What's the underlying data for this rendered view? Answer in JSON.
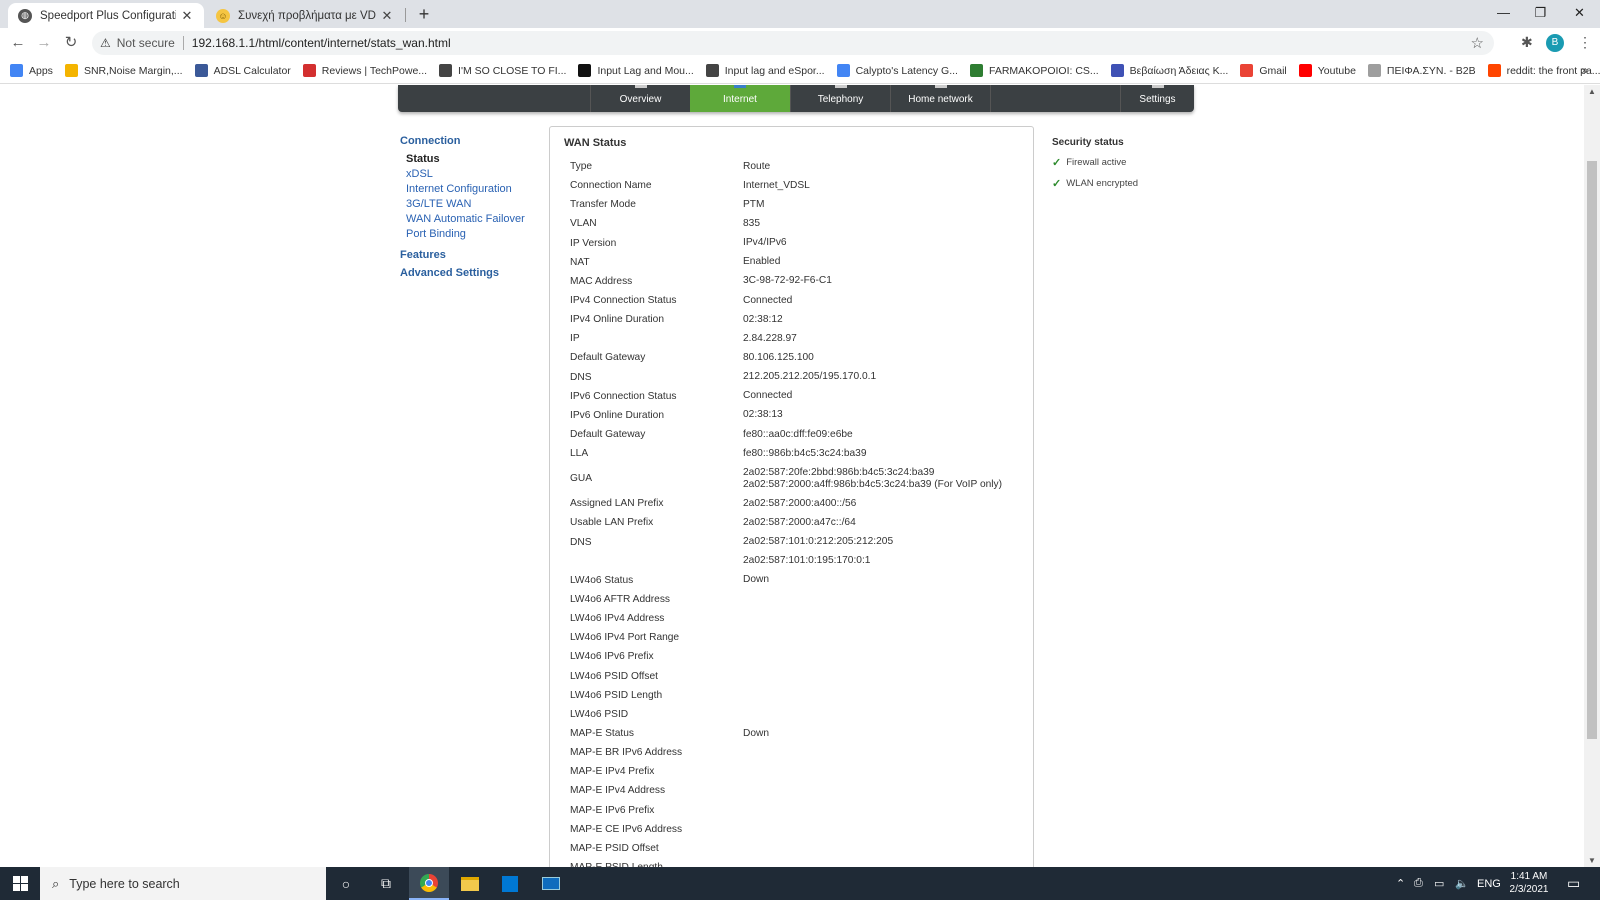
{
  "browser": {
    "tabs": [
      {
        "title": "Speedport Plus Configuration Pr",
        "favicon": "globe-icon"
      },
      {
        "title": "Συνεχή προβλήματα με VDSL Co",
        "favicon": "forum-icon"
      }
    ],
    "new_tab": "+",
    "security_label": "Not secure",
    "url": "192.168.1.1/html/content/internet/stats_wan.html",
    "profile_initial": "B"
  },
  "bookmarks": [
    {
      "label": "Apps",
      "color": "#4285f4"
    },
    {
      "label": "SNR,Noise Margin,...",
      "color": "#f4b400"
    },
    {
      "label": "ADSL Calculator",
      "color": "#3b5998"
    },
    {
      "label": "Reviews | TechPowe...",
      "color": "#d32f2f"
    },
    {
      "label": "I'M SO CLOSE TO FI...",
      "color": "#444444"
    },
    {
      "label": "Input Lag and Mou...",
      "color": "#111111"
    },
    {
      "label": "Input lag and eSpor...",
      "color": "#444444"
    },
    {
      "label": "Calypto's Latency G...",
      "color": "#4285f4"
    },
    {
      "label": "FARMAKOPOIOI: CS...",
      "color": "#2e7d32"
    },
    {
      "label": "Βεβαίωση Άδειας Κ...",
      "color": "#3f51b5"
    },
    {
      "label": "Gmail",
      "color": "#ea4335"
    },
    {
      "label": "Youtube",
      "color": "#ff0000"
    },
    {
      "label": "ΠΕΙΦΑ.ΣΥΝ. - B2B",
      "color": "#9e9e9e"
    },
    {
      "label": "reddit: the front pa...",
      "color": "#ff4500"
    }
  ],
  "topnav": {
    "items": [
      "Overview",
      "Internet",
      "Telephony",
      "Home network",
      "Settings"
    ],
    "active": "Internet",
    "active_color": "#5ea93a"
  },
  "leftnav": {
    "connection": "Connection",
    "sub_items": [
      "Status",
      "xDSL",
      "Internet Configuration",
      "3G/LTE WAN",
      "WAN Automatic Failover",
      "Port Binding"
    ],
    "current": "Status",
    "features": "Features",
    "advanced": "Advanced Settings"
  },
  "wan": {
    "title": "WAN Status",
    "rows": [
      {
        "k": "Type",
        "v": "Route"
      },
      {
        "k": "Connection Name",
        "v": "Internet_VDSL"
      },
      {
        "k": "Transfer Mode",
        "v": "PTM"
      },
      {
        "k": "VLAN",
        "v": "835"
      },
      {
        "k": "IP Version",
        "v": "IPv4/IPv6"
      },
      {
        "k": "NAT",
        "v": "Enabled"
      },
      {
        "k": "MAC Address",
        "v": "3C-98-72-92-F6-C1"
      },
      {
        "k": "IPv4 Connection Status",
        "v": "Connected"
      },
      {
        "k": "IPv4 Online Duration",
        "v": "02:38:12"
      },
      {
        "k": "IP",
        "v": "2.84.228.97"
      },
      {
        "k": "Default Gateway",
        "v": "80.106.125.100"
      },
      {
        "k": "DNS",
        "v": "212.205.212.205/195.170.0.1"
      },
      {
        "k": "IPv6 Connection Status",
        "v": "Connected"
      },
      {
        "k": "IPv6 Online Duration",
        "v": "02:38:13"
      },
      {
        "k": "Default Gateway",
        "v": "fe80::aa0c:dff:fe09:e6be"
      },
      {
        "k": "LLA",
        "v": "fe80::986b:b4c5:3c24:ba39"
      },
      {
        "k": "GUA",
        "v": "2a02:587:20fe:2bbd:986b:b4c5:3c24:ba39",
        "v2": "2a02:587:2000:a4ff:986b:b4c5:3c24:ba39 (For VoIP only)"
      },
      {
        "k": "Assigned LAN Prefix",
        "v": "2a02:587:2000:a400::/56"
      },
      {
        "k": "Usable LAN Prefix",
        "v": "2a02:587:2000:a47c::/64"
      },
      {
        "k": "DNS",
        "v": "2a02:587:101:0:212:205:212:205"
      },
      {
        "k": "",
        "v": "2a02:587:101:0:195:170:0:1"
      },
      {
        "k": "LW4o6 Status",
        "v": "Down"
      },
      {
        "k": "LW4o6 AFTR Address",
        "v": ""
      },
      {
        "k": "LW4o6 IPv4 Address",
        "v": ""
      },
      {
        "k": "LW4o6 IPv4 Port Range",
        "v": ""
      },
      {
        "k": "LW4o6 IPv6 Prefix",
        "v": ""
      },
      {
        "k": "LW4o6 PSID Offset",
        "v": ""
      },
      {
        "k": "LW4o6 PSID Length",
        "v": ""
      },
      {
        "k": "LW4o6 PSID",
        "v": ""
      },
      {
        "k": "MAP-E Status",
        "v": "Down"
      },
      {
        "k": "MAP-E BR IPv6 Address",
        "v": ""
      },
      {
        "k": "MAP-E IPv4 Prefix",
        "v": ""
      },
      {
        "k": "MAP-E IPv4 Address",
        "v": ""
      },
      {
        "k": "MAP-E IPv6 Prefix",
        "v": ""
      },
      {
        "k": "MAP-E CE IPv6 Address",
        "v": ""
      },
      {
        "k": "MAP-E PSID Offset",
        "v": ""
      },
      {
        "k": "MAP-E PSID Length",
        "v": ""
      }
    ]
  },
  "security": {
    "title": "Security status",
    "items": [
      "Firewall active",
      "WLAN encrypted"
    ]
  },
  "taskbar": {
    "search_placeholder": "Type here to search",
    "language": "ENG",
    "time": "1:41 AM",
    "date": "2/3/2021"
  }
}
